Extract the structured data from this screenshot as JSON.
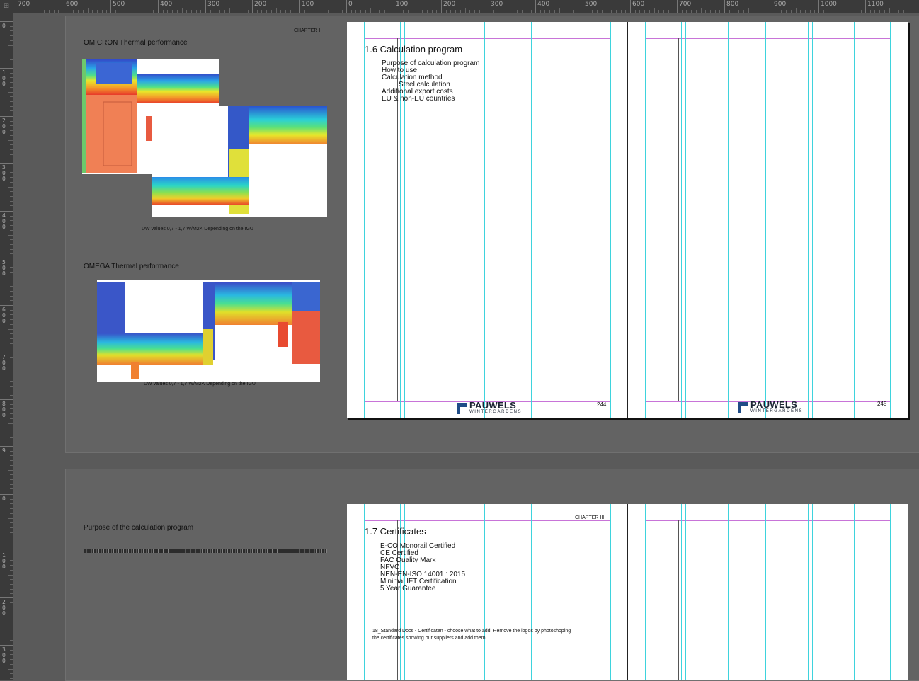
{
  "ruler": {
    "corner": "⊞",
    "top_labels": [
      "700",
      "600",
      "500",
      "400",
      "300",
      "200",
      "100",
      "0",
      "100",
      "200",
      "300",
      "400",
      "500",
      "600",
      "700",
      "800",
      "900",
      "1000",
      "1100"
    ],
    "left_labels": [
      "0",
      "100",
      "200",
      "300",
      "400",
      "500",
      "600",
      "700",
      "800",
      "9",
      "0",
      "100",
      "200",
      "300"
    ]
  },
  "spread1": {
    "left": {
      "chapter": "CHAPTER II",
      "omicron_title": "OMICRON Thermal performance",
      "omicron_caption": "UW values 0,7 - 1,7 W/M2K Depending on the IGU",
      "omega_title": "OMEGA Thermal performance",
      "omega_caption": "UW values 0,7 - 1,7 W/M2K Depending on the IGU"
    },
    "page_244": {
      "heading": "1.6 Calculation program",
      "items": [
        {
          "text": "Purpose of calculation program",
          "indent": 0
        },
        {
          "text": "How to use",
          "indent": 0
        },
        {
          "text": "Calculation method",
          "indent": 0
        },
        {
          "text": "Steel calculation",
          "indent": 1
        },
        {
          "text": "Additional export costs",
          "indent": 0
        },
        {
          "text": "EU & non-EU countries",
          "indent": 0
        }
      ],
      "logo_name": "PAUWELS",
      "logo_sub": "WINTERGARDENS",
      "page_number": "244"
    },
    "page_245": {
      "logo_name": "PAUWELS",
      "logo_sub": "WINTERGARDENS",
      "page_number": "245"
    }
  },
  "spread2": {
    "left": {
      "purpose_title": "Purpose of the calculation program"
    },
    "page_right": {
      "chapter": "CHAPTER III",
      "heading": "1.7 Certificates",
      "items": [
        "E-CO Monorail Certified",
        "CE Certified",
        "FAC Quality Mark",
        "NFVC",
        "NEN-EN-ISO 14001 : 2015",
        "Minimal IFT Certification",
        "5 Year Guarantee"
      ],
      "note_line1": "18_Standard Docs - Certificaten - choose what to add. Remove the logos by photoshoping",
      "note_line2": "the certificates showing our suppliers and add them"
    }
  },
  "colors": {
    "guide_cyan": "#3ed3dd",
    "margin_magenta": "#c874d8",
    "brand_blue": "#1f4c87"
  },
  "icons": [
    "pauwels-logo-icon",
    "ruler-origin-icon"
  ]
}
